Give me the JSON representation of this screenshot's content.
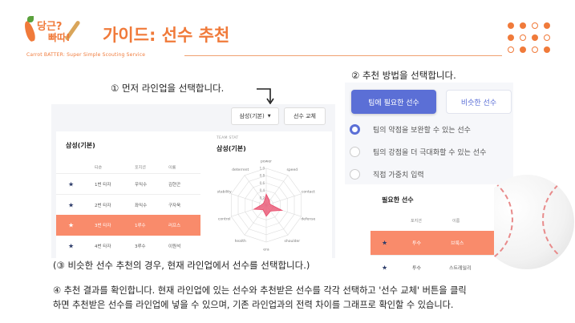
{
  "header": {
    "logo_line1": "당근?",
    "logo_line2": "빠따!",
    "title": "가이드: 선수 추천",
    "subtitle": "Carrot BATTER: Super Simple Scouting Service"
  },
  "steps": {
    "step1": "① 먼저 라인업을 선택합니다.",
    "step2": "② 추천 방법을 선택합니다.",
    "step3": "(③ 비슷한 선수 추천의 경우, 현재 라인업에서 선수를 선택합니다.)",
    "step4_line1": "④ 추천 결과를 확인합니다. 현재 라인업에 있는 선수와 추천받은 선수를 각각 선택하고 '선수 교체' 버튼을 클릭",
    "step4_line2": "하면 추천받은 선수를 라인업에 넣을 수 있으며, 기존 라인업과의 전력 차이를 그래프로 확인할 수 있습니다."
  },
  "lineup_panel": {
    "dropdown_value": "삼성(기본)",
    "swap_button": "선수 교체",
    "card_title": "삼성(기본)",
    "columns": [
      "타순",
      "포지션",
      "이름"
    ],
    "rows": [
      {
        "order": "1번 타자",
        "position": "우익수",
        "name": "김현곤",
        "selected": false
      },
      {
        "order": "2번 타자",
        "position": "좌익수",
        "name": "구자욱",
        "selected": false
      },
      {
        "order": "3번 타자",
        "position": "1루수",
        "name": "러프스",
        "selected": true
      },
      {
        "order": "4번 타자",
        "position": "3루수",
        "name": "이원석",
        "selected": false
      }
    ]
  },
  "team_stat": {
    "label": "TEAM STAT",
    "team": "삼성(기본)",
    "chart_data": {
      "type": "radar",
      "axes": [
        "power",
        "speed",
        "contact",
        "defense",
        "shoulder",
        "era",
        "health",
        "control",
        "stability",
        "deterrent"
      ],
      "ticks": [
        "1.0",
        "0.8",
        "0.6",
        "0.4",
        "0.2"
      ],
      "range": [
        0,
        1
      ],
      "series": [
        {
          "values": [
            0.3,
            0.15,
            0.1,
            0.45,
            0.2,
            0.3,
            0.15,
            0.35,
            0.1,
            0.1
          ]
        }
      ],
      "color": "#e84a6a"
    }
  },
  "method_panel": {
    "primary_tab": "팀에 필요한 선수",
    "secondary_tab": "비슷한 선수",
    "options": [
      {
        "label": "팀의 약점을 보완할 수 있는 선수",
        "selected": true
      },
      {
        "label": "팀의 강점을 더 극대화할 수 있는 선수",
        "selected": false
      },
      {
        "label": "직접 가중치 입력",
        "selected": false
      }
    ]
  },
  "recommend_card": {
    "title": "필요한 선수",
    "columns": [
      "포지션",
      "이름"
    ],
    "rows": [
      {
        "position": "투수",
        "name": "브룩스",
        "selected": true
      },
      {
        "position": "투수",
        "name": "스트레일리",
        "selected": false
      }
    ]
  },
  "colors": {
    "accent": "#f07a3a",
    "selected_row": "#f98b6b",
    "primary": "#5b6fd6",
    "star": "#2e3d6a"
  }
}
